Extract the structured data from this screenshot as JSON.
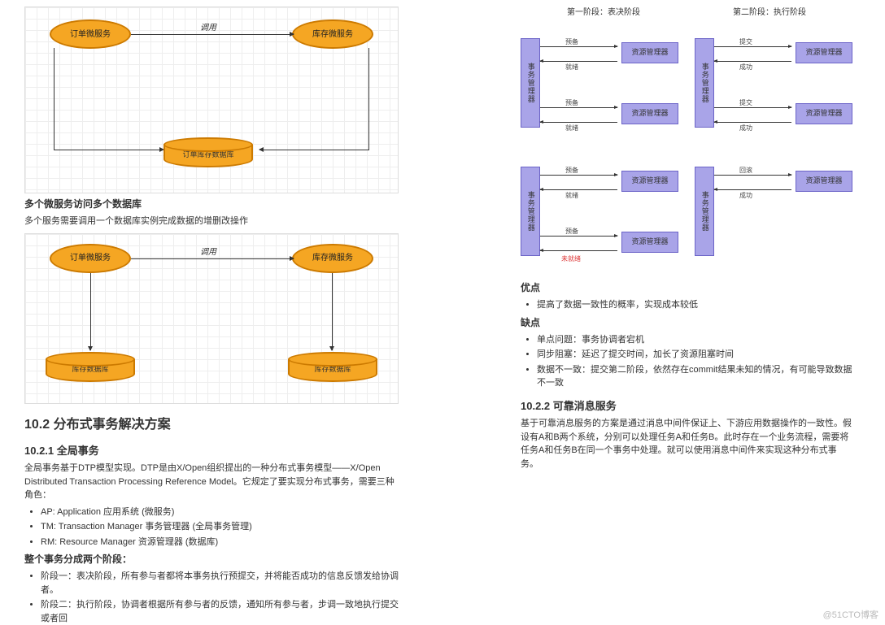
{
  "left": {
    "diagram1": {
      "node_order": "订单微服务",
      "node_stock": "库存微服务",
      "edge_call": "调用",
      "db": "订单库存数据库"
    },
    "multi_db_heading": "多个微服务访问多个数据库",
    "multi_db_desc": "多个服务需要调用一个数据库实例完成数据的增删改操作",
    "diagram2": {
      "node_order": "订单微服务",
      "node_stock": "库存微服务",
      "edge_call": "调用",
      "db_left": "库存数据库",
      "db_right": "库存数据库"
    },
    "section_10_2": "10.2 分布式事务解决方案",
    "section_10_2_1": "10.2.1 全局事务",
    "global_desc": "全局事务基于DTP模型实现。DTP是由X/Open组织提出的一种分布式事务模型——X/Open Distributed Transaction Processing Reference Model。它规定了要实现分布式事务，需要三种角色：",
    "roles": [
      "AP: Application 应用系统 (微服务)",
      "TM: Transaction Manager 事务管理器 (全局事务管理)",
      "RM: Resource Manager 资源管理器 (数据库)"
    ],
    "two_phase_heading": "整个事务分成两个阶段：",
    "phases_desc": [
      "阶段一：表决阶段，所有参与者都将本事务执行预提交，并将能否成功的信息反馈发给协调者。",
      "阶段二：执行阶段，协调者根据所有参与者的反馈，通知所有参与者，步调一致地执行提交或者回"
    ]
  },
  "right": {
    "phase1_title": "第一阶段：表决阶段",
    "phase2_title": "第二阶段：执行阶段",
    "tm_label": "事务管理器",
    "rm_label": "资源管理器",
    "lbl_prepare": "预备",
    "lbl_ready": "就绪",
    "lbl_commit": "提交",
    "lbl_success": "成功",
    "lbl_rollback": "回滚",
    "lbl_notready": "未就绪",
    "adv_heading": "优点",
    "adv_items": [
      "提高了数据一致性的概率，实现成本较低"
    ],
    "dis_heading": "缺点",
    "dis_items": [
      "单点问题：事务协调者宕机",
      "同步阻塞：延迟了提交时间，加长了资源阻塞时间",
      "数据不一致：提交第二阶段，依然存在commit结果未知的情况，有可能导致数据不一致"
    ],
    "section_10_2_2": "10.2.2 可靠消息服务",
    "reliable_desc": "基于可靠消息服务的方案是通过消息中间件保证上、下游应用数据操作的一致性。假设有A和B两个系统，分别可以处理任务A和任务B。此时存在一个业务流程，需要将任务A和任务B在同一个事务中处理。就可以使用消息中间件来实现这种分布式事务。"
  },
  "watermark": "@51CTO博客"
}
